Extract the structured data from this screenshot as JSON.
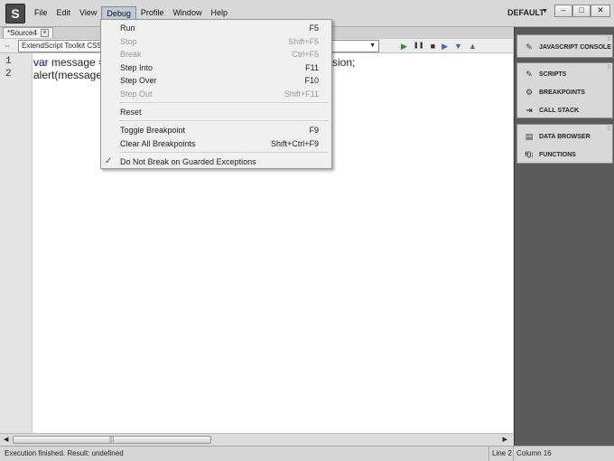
{
  "app": {
    "logo_glyph": "S",
    "menus": [
      "File",
      "Edit",
      "View",
      "Debug",
      "Profile",
      "Window",
      "Help"
    ],
    "active_menu": "Debug",
    "workspace": "DEFAULT",
    "window_controls": [
      "–",
      "□",
      "✕"
    ]
  },
  "tab": {
    "label": "*Source4",
    "close": "×"
  },
  "toolbar": {
    "target": "ExtendScript Toolkit CS5",
    "link_glyph": "⇔",
    "controls": [
      "▶",
      "❚❚",
      "■",
      "▶",
      "▼",
      "▲"
    ]
  },
  "editor": {
    "line_numbers": [
      "1",
      "2"
    ],
    "line1": {
      "keyword": "var",
      "text_before": " message = ",
      "text_after": "sion;"
    },
    "line2": "alert(message);"
  },
  "debug_menu": {
    "items": [
      {
        "label": "Run",
        "shortcut": "F5",
        "enabled": true
      },
      {
        "label": "Stop",
        "shortcut": "Shift+F5",
        "enabled": false
      },
      {
        "label": "Break",
        "shortcut": "Ctrl+F5",
        "enabled": false
      },
      {
        "label": "Step Into",
        "shortcut": "F11",
        "enabled": true
      },
      {
        "label": "Step Over",
        "shortcut": "F10",
        "enabled": true
      },
      {
        "label": "Step Out",
        "shortcut": "Shift+F11",
        "enabled": false
      },
      {
        "label": "Reset",
        "shortcut": "",
        "enabled": true
      },
      {
        "label": "Toggle Breakpoint",
        "shortcut": "F9",
        "enabled": true
      },
      {
        "label": "Clear All Breakpoints",
        "shortcut": "Shift+Ctrl+F9",
        "enabled": true
      },
      {
        "label": "Do Not Break on Guarded Exceptions",
        "shortcut": "",
        "enabled": true,
        "checked": true
      }
    ],
    "check_glyph": "✓"
  },
  "right_panel": {
    "group1": [
      {
        "label": "JAVASCRIPT CONSOLE",
        "icon": "console-icon"
      }
    ],
    "group2": [
      {
        "label": "SCRIPTS",
        "icon": "scripts-icon"
      },
      {
        "label": "BREAKPOINTS",
        "icon": "breakpoints-icon"
      },
      {
        "label": "CALL STACK",
        "icon": "call-stack-icon"
      }
    ],
    "group3": [
      {
        "label": "DATA BROWSER",
        "icon": "data-browser-icon"
      },
      {
        "label": "FUNCTIONS",
        "icon": "functions-icon"
      }
    ],
    "functions_glyph": "f();"
  },
  "status": {
    "message": "Execution finished. Result: undefined",
    "line": "Line 2",
    "column": "Column 16"
  },
  "colors": {
    "keyword": "#0000cc",
    "panel_bg": "#5a5a5a",
    "check": "#2b4f9e"
  }
}
